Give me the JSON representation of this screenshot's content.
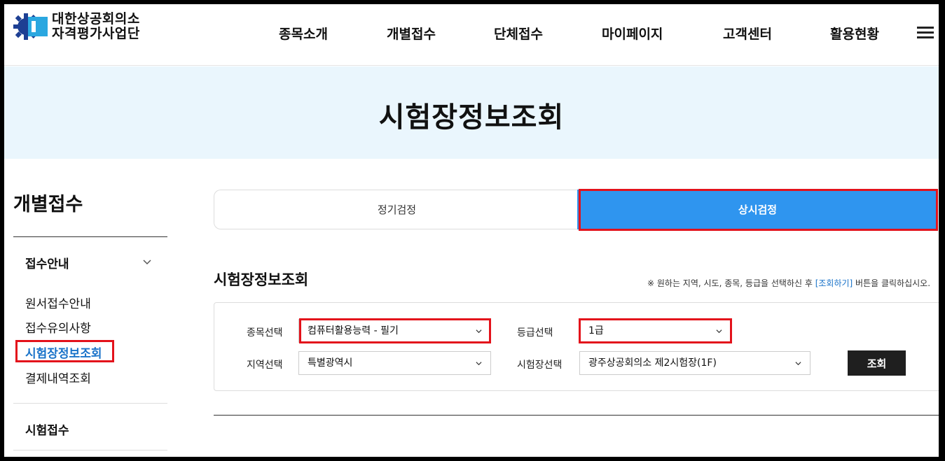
{
  "header": {
    "logo_line1": "대한상공회의소",
    "logo_line2": "자격평가사업단",
    "nav": [
      "종목소개",
      "개별접수",
      "단체접수",
      "마이페이지",
      "고객센터",
      "활용현황"
    ],
    "menu_icon": "hamburger-icon"
  },
  "hero": {
    "title": "시험장정보조회"
  },
  "sidebar": {
    "title": "개별접수",
    "group1": "접수안내",
    "links": [
      "원서접수안내",
      "접수유의사항",
      "시험장정보조회",
      "결제내역조회"
    ],
    "active_link": "시험장정보조회",
    "group2": "시험접수"
  },
  "tabs": {
    "left": "정기검정",
    "right": "상시검정",
    "active": "상시검정"
  },
  "section": {
    "title": "시험장정보조회",
    "hint_prefix": "※ 원하는 지역, 시도, 종목, 등급을 선택하신 후 ",
    "hint_link": "[조회하기]",
    "hint_suffix": " 버튼을 클릭하십시오."
  },
  "form": {
    "subject_label": "종목선택",
    "subject_value": "컴퓨터활용능력 - 필기",
    "grade_label": "등급선택",
    "grade_value": "1급",
    "region_label": "지역선택",
    "region_value": "특별광역시",
    "venue_label": "시험장선택",
    "venue_value": "광주상공회의소 제2시험장(1F)",
    "search_button": "조회"
  },
  "colors": {
    "accent": "#2f95ef",
    "highlight": "#e3121b",
    "link": "#1a73c9",
    "hero_bg": "#eaf6fd"
  }
}
